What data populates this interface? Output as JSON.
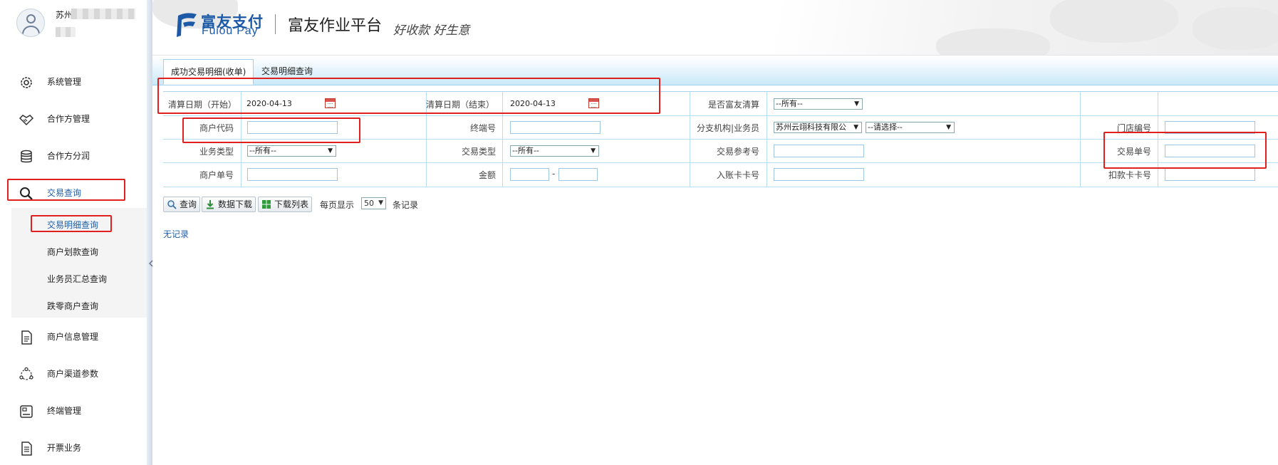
{
  "user": {
    "name": "苏州"
  },
  "header": {
    "logo_cn": "富友支付",
    "logo_en": "Fuiou Pay",
    "platform_title": "富友作业平台",
    "slogan": "好收款 好生意"
  },
  "sidebar": {
    "items": [
      {
        "label": "系统管理",
        "icon": "gear-icon"
      },
      {
        "label": "合作方管理",
        "icon": "handshake-icon"
      },
      {
        "label": "合作方分润",
        "icon": "database-icon"
      },
      {
        "label": "交易查询",
        "icon": "search-icon"
      },
      {
        "label": "商户信息管理",
        "icon": "document-icon"
      },
      {
        "label": "商户渠道参数",
        "icon": "network-icon"
      },
      {
        "label": "终端管理",
        "icon": "terminal-icon"
      },
      {
        "label": "开票业务",
        "icon": "invoice-icon"
      }
    ],
    "sub_items": [
      {
        "label": "交易明细查询"
      },
      {
        "label": "商户划款查询"
      },
      {
        "label": "业务员汇总查询"
      },
      {
        "label": "跌零商户查询"
      }
    ]
  },
  "tabs": [
    {
      "label": "成功交易明细(收单)"
    },
    {
      "label": "交易明细查询"
    }
  ],
  "form": {
    "settle_date_start": {
      "label": "清算日期（开始）",
      "value": "2020-04-13"
    },
    "settle_date_end": {
      "label": "清算日期（结束）",
      "value": "2020-04-13"
    },
    "fuiou_settle": {
      "label": "是否富友清算",
      "value": "--所有--"
    },
    "merchant_code": {
      "label": "商户代码",
      "value": ""
    },
    "terminal_no": {
      "label": "终端号",
      "value": ""
    },
    "branch_salesman": {
      "label": "分支机构|业务员",
      "branch_value": "苏州云翊科技有限公",
      "salesman_value": "--请选择--"
    },
    "store_no": {
      "label": "门店编号",
      "value": ""
    },
    "business_type": {
      "label": "业务类型",
      "value": "--所有--"
    },
    "trade_type": {
      "label": "交易类型",
      "value": "--所有--"
    },
    "trade_ref_no": {
      "label": "交易参考号",
      "value": ""
    },
    "trade_order_no": {
      "label": "交易单号",
      "value": ""
    },
    "merchant_order_no": {
      "label": "商户单号",
      "value": ""
    },
    "amount": {
      "label": "金额",
      "from": "",
      "to": "",
      "separator": "-"
    },
    "credit_card_no": {
      "label": "入账卡卡号",
      "value": ""
    },
    "debit_card_no": {
      "label": "扣款卡卡号",
      "value": ""
    }
  },
  "toolbar": {
    "query_label": "查询",
    "download_data_label": "数据下载",
    "download_list_label": "下载列表",
    "per_page_prefix": "每页显示",
    "per_page_value": "50",
    "per_page_suffix": "条记录"
  },
  "results": {
    "empty_text": "无记录"
  },
  "colors": {
    "brand": "#1c5aa8",
    "annotation": "#e0201f",
    "table_border": "#b8dcf2"
  }
}
